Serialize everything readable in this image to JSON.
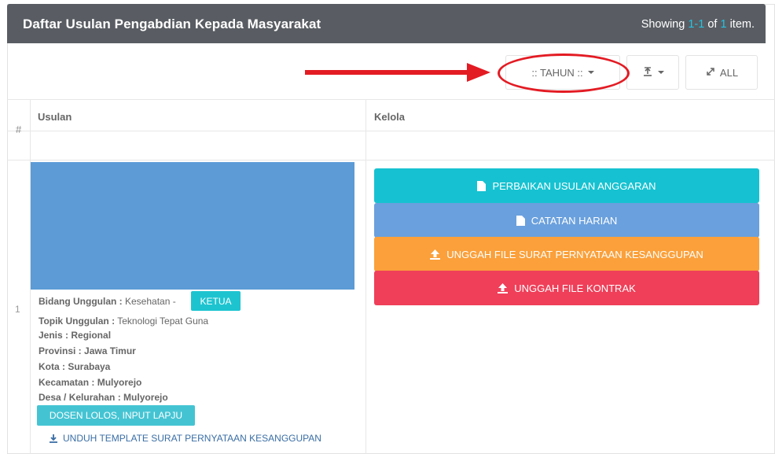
{
  "header": {
    "title": "Daftar Usulan Pengabdian Kepada Masyarakat",
    "summary_prefix": "Showing ",
    "summary_range": "1-1",
    "summary_of": " of ",
    "summary_total": "1",
    "summary_suffix": " item."
  },
  "toolbar": {
    "tahun_label": ":: TAHUN ::",
    "all_label": "ALL",
    "export_icon": "export-icon",
    "expand_icon": "expand-icon"
  },
  "table": {
    "col_num": "#",
    "col_usulan": "Usulan",
    "col_kelola": "Kelola"
  },
  "row": {
    "num": "1",
    "bidang_label": "Bidang Unggulan :",
    "bidang_value": " Kesehatan -",
    "role_badge": "KETUA",
    "topik_label": "Topik Unggulan :",
    "topik_value": " Teknologi Tepat Guna",
    "jenis": "Jenis : Regional",
    "provinsi": "Provinsi : Jawa Timur",
    "kota": "Kota : Surabaya",
    "kecamatan": "Kecamatan : Mulyorejo",
    "desa": "Desa / Kelurahan : Mulyorejo",
    "status_badge": "DOSEN LOLOS, INPUT LAPJU",
    "download_label": "UNDUH TEMPLATE SURAT PERNYATAAN KESANGGUPAN"
  },
  "actions": [
    {
      "label": "PERBAIKAN USULAN ANGGARAN",
      "icon": "file-icon",
      "color": "#16c2d1"
    },
    {
      "label": "CATATAN HARIAN",
      "icon": "file-icon",
      "color": "#6aa0dd"
    },
    {
      "label": "UNGGAH FILE SURAT PERNYATAAN KESANGGUPAN",
      "icon": "upload-icon",
      "color": "#fba03a"
    },
    {
      "label": "UNGGAH FILE KONTRAK",
      "icon": "upload-icon",
      "color": "#ef3f59"
    }
  ],
  "colors": {
    "header_bg": "#595d63",
    "accent": "#25c2e0",
    "annotation": "#e31b23"
  }
}
